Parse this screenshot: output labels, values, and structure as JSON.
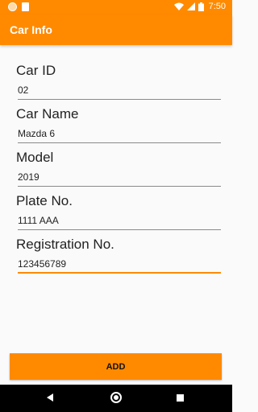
{
  "status_bar": {
    "time": "7:50"
  },
  "app_bar": {
    "title": "Car Info"
  },
  "form": {
    "fields": [
      {
        "label": "Car ID",
        "value": "02"
      },
      {
        "label": "Car Name",
        "value": "Mazda 6"
      },
      {
        "label": "Model",
        "value": "2019"
      },
      {
        "label": "Plate No.",
        "value": "1111 AAA"
      },
      {
        "label": "Registration No.",
        "value": "123456789"
      }
    ]
  },
  "actions": {
    "add_label": "ADD"
  },
  "colors": {
    "accent": "#ff8a00",
    "nav_bar": "#000000"
  }
}
